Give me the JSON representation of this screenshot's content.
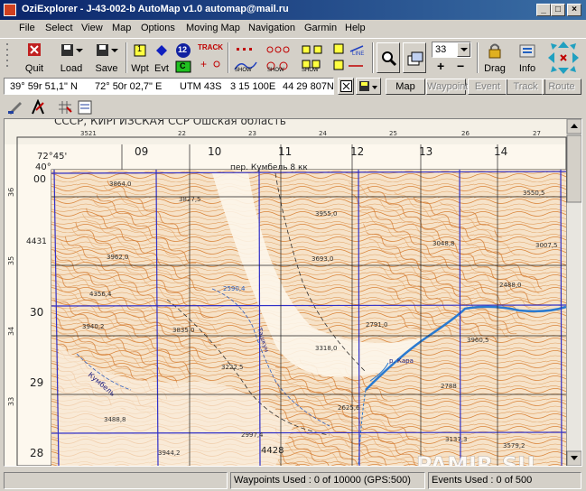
{
  "window": {
    "title": "OziExplorer - J-43-002-b AutoMap v1.0 automap@mail.ru",
    "minimize": "_",
    "maximize": "□",
    "close": "×"
  },
  "menu": [
    "File",
    "Select",
    "View",
    "Map",
    "Options",
    "Moving Map",
    "Navigation",
    "Garmin",
    "Help"
  ],
  "toolbar": {
    "quit": "Quit",
    "load": "Load",
    "save": "Save",
    "wpt": "Wpt",
    "evt": "Evt",
    "wpt_num": "1",
    "circle_num": "12",
    "track_label": "TRACK",
    "c_label": "C",
    "show_label": "SHOW",
    "line_label": "LINE",
    "zoom_value": "33",
    "zoom_in": "+",
    "zoom_out": "−",
    "drag": "Drag",
    "info": "Info"
  },
  "coords": {
    "lat": "39° 59r 51,1\" N",
    "lon": "72° 50r 02,7\" E",
    "zone": "UTM  43S",
    "easting": "3 15 100E",
    "northing": "44 29 807N"
  },
  "modes": [
    {
      "label": "Map",
      "enabled": true
    },
    {
      "label": "Waypoint",
      "enabled": false
    },
    {
      "label": "Event",
      "enabled": false
    },
    {
      "label": "Track",
      "enabled": false
    },
    {
      "label": "Route",
      "enabled": false
    }
  ],
  "map": {
    "header_left": "СССР, КИРГИЗСКАЯ ССР  Ошская область",
    "pass_label": "пер. Кумбель 8 кк",
    "corner_lon": "72°45'",
    "corner_lat": "40°",
    "top_grid": [
      "09",
      "10",
      "11",
      "12",
      "13",
      "14"
    ],
    "top_small": [
      "3521",
      "22",
      "23",
      "24",
      "25",
      "26",
      "27"
    ],
    "left_grid": [
      "00",
      "4431",
      "30",
      "29",
      "28"
    ],
    "left_small": [
      "36",
      "35",
      "34",
      "33"
    ],
    "bottom_num": "4428",
    "elevations": [
      "3864,0",
      "3827,5",
      "3955,0",
      "3550,5",
      "3962,0",
      "3693,0",
      "3048,8",
      "3007,5",
      "4356,4",
      "2590,4",
      "2488,0",
      "3940,2",
      "3835,0",
      "2791,0",
      "3960,5",
      "3318,0",
      "3222,5",
      "2788",
      "2625,6",
      "3488,8",
      "2997,4",
      "3579,2",
      "3944,2",
      "3137,3"
    ],
    "river_labels": [
      "Кумбель",
      "Ташкун",
      "р. Кара"
    ],
    "watermark": "PAMIR.SU"
  },
  "status": {
    "left": "",
    "waypoints": "Waypoints Used : 0 of 10000  (GPS:500)",
    "events": "Events Used : 0 of 500"
  },
  "colors": {
    "titlebar": "#0a246a",
    "contour": "#d9843a",
    "grid": "#3030c8",
    "river": "#2a7ad0"
  }
}
